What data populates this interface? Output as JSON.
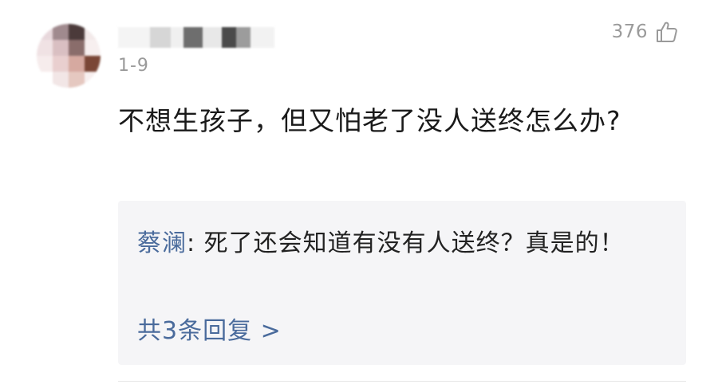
{
  "comment": {
    "date": "1-9",
    "like_count": "376",
    "text": "不想生孩子，但又怕老了没人送终怎么办?",
    "icons": {
      "like": "thumbs-up-icon",
      "avatar": "blurred-avatar"
    }
  },
  "reply": {
    "author": "蔡澜",
    "separator": ": ",
    "text": "死了还会知道有没有人送终？真是的！",
    "more_link": "共3条回复 >"
  },
  "colors": {
    "link": "#4a6b9c",
    "meta": "#9a9a9a",
    "reply_bg": "#f5f5f7"
  }
}
